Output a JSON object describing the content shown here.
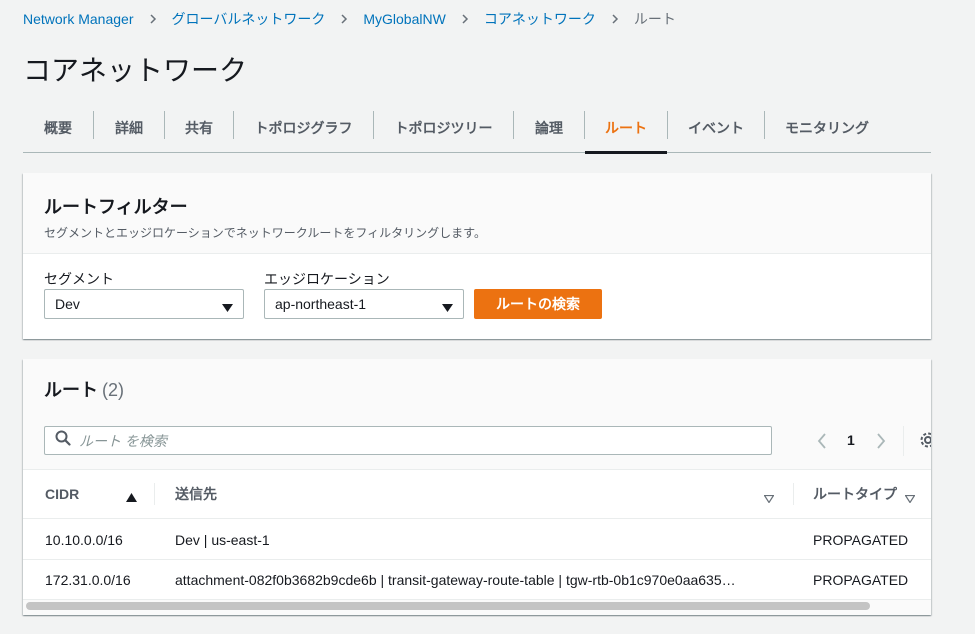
{
  "breadcrumb": {
    "items": [
      "Network Manager",
      "グローバルネットワーク",
      "MyGlobalNW",
      "コアネットワーク"
    ],
    "current": "ルート"
  },
  "page": {
    "title": "コアネットワーク"
  },
  "tabs": {
    "items": [
      "概要",
      "詳細",
      "共有",
      "トポロジグラフ",
      "トポロジツリー",
      "論理",
      "ルート",
      "イベント",
      "モニタリング"
    ],
    "active": "ルート"
  },
  "filter": {
    "title": "ルートフィルター",
    "description": "セグメントとエッジロケーションでネットワークルートをフィルタリングします。",
    "segment_label": "セグメント",
    "segment_value": "Dev",
    "edge_label": "エッジロケーション",
    "edge_value": "ap-northeast-1",
    "search_button": "ルートの検索"
  },
  "routes": {
    "title": "ルート",
    "count": "(2)",
    "search_placeholder": "ルート を検索",
    "page": "1",
    "columns": [
      "CIDR",
      "送信先",
      "ルートタイプ"
    ],
    "rows": [
      {
        "cidr": "10.10.0.0/16",
        "destination": "Dev | us-east-1",
        "type": "PROPAGATED"
      },
      {
        "cidr": "172.31.0.0/16",
        "destination": "attachment-082f0b3682b9cde6b | transit-gateway-route-table | tgw-rtb-0b1c970e0aa635…",
        "type": "PROPAGATED"
      }
    ]
  },
  "colors": {
    "accent": "#ec7211",
    "link": "#0073bb",
    "text": "#16191f",
    "muted": "#545b64"
  },
  "icons": [
    "chevron-right-icon",
    "caret-down-icon",
    "search-icon",
    "chevron-left-icon",
    "settings-gear-icon",
    "sort-ascending-icon",
    "sort-icon"
  ]
}
